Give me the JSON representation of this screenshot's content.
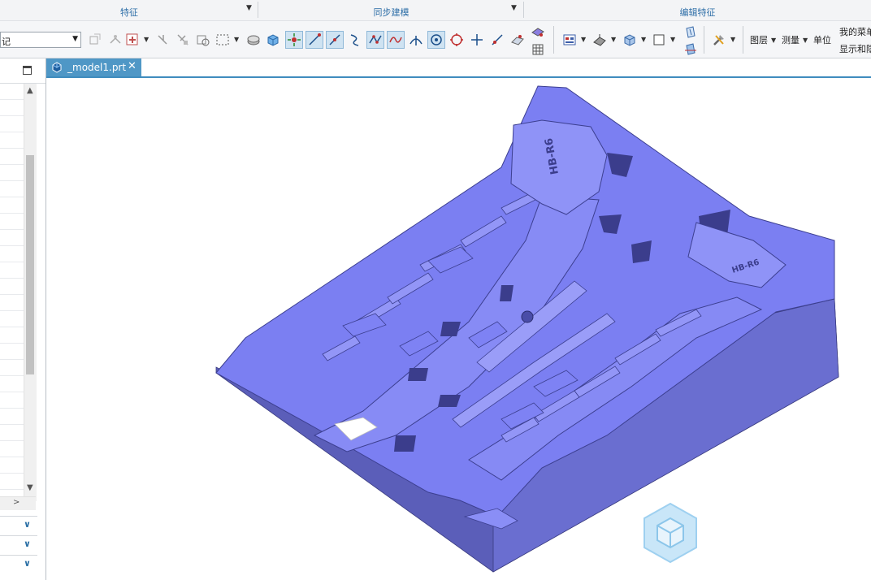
{
  "ribbon": {
    "groups": [
      {
        "label": "特征"
      },
      {
        "label": "同步建模"
      },
      {
        "label": "编辑特征"
      }
    ],
    "selection_filter": {
      "value": "记"
    },
    "menu_items": {
      "layer": "图层",
      "measure": "测量",
      "units": "单位",
      "my_menu": "我的菜单",
      "show_hide": "显示和隐"
    }
  },
  "tabs": [
    {
      "label": "_model1.prt",
      "close": "✕"
    }
  ],
  "panel": {
    "scroll_up": "▲",
    "scroll_down": "▼",
    "scroll_right": ">",
    "sections": [
      {
        "chevron": "∨"
      },
      {
        "chevron": "∨"
      },
      {
        "chevron": "∨"
      }
    ]
  },
  "model": {
    "embossed_text_left": "HB-R6",
    "embossed_text_right": "HB-R6"
  },
  "colors": {
    "model_top": "#7a7ef2",
    "model_side_dark": "#5a5db8",
    "model_side_light": "#6b6ed0",
    "tab_active": "#4f97c6",
    "group_label": "#2f6fa8"
  }
}
